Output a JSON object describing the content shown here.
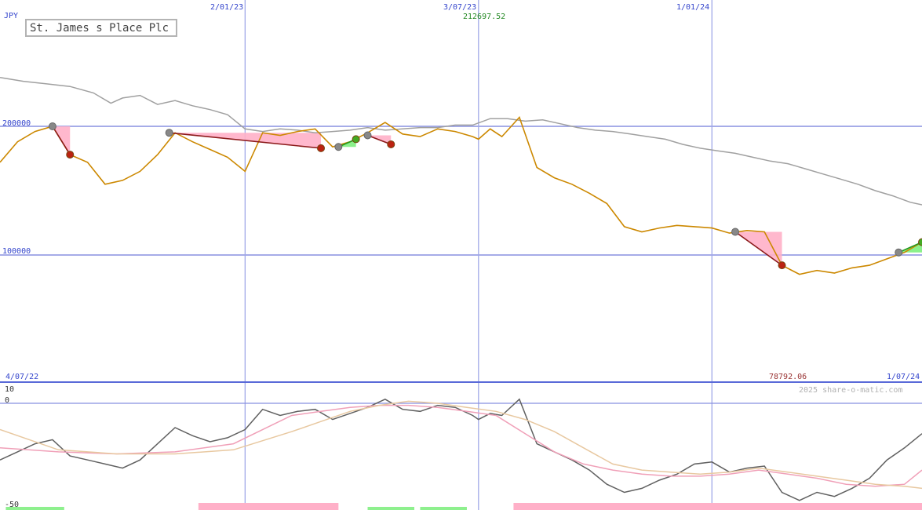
{
  "chart_data": {
    "type": "line",
    "title": "St. James s Place Plc",
    "currency": "JPY",
    "watermark": "2025 share-o-matic.com",
    "start_date_label": "4/07/22",
    "end_date_label": "1/07/24",
    "x_gridlines": [
      {
        "label": "2/01/23",
        "x": 42
      },
      {
        "label": "3/07/23",
        "x": 82
      },
      {
        "label": "1/01/24",
        "x": 122
      }
    ],
    "price_axis": {
      "ylim": [
        20000,
        300000
      ],
      "ticks": [
        {
          "label": "200000",
          "value": 200000
        },
        {
          "label": "100000",
          "value": 100000
        }
      ],
      "max_label": "212697.52",
      "min_label": "78792.06",
      "max_value": 212697.52,
      "min_value": 78792.06
    },
    "price_series": {
      "name": "",
      "color": "#cc8800",
      "x": [
        0,
        3,
        6,
        9,
        12,
        15,
        18,
        21,
        24,
        27,
        30,
        33,
        36,
        39,
        42,
        45,
        48,
        51,
        54,
        57,
        60,
        63,
        66,
        69,
        72,
        75,
        78,
        81,
        82,
        84,
        86,
        89,
        92,
        95,
        98,
        101,
        104,
        107,
        110,
        113,
        116,
        119,
        122,
        125,
        128,
        131,
        134,
        137,
        140,
        143,
        146,
        149,
        152,
        155,
        158
      ],
      "values": [
        172000,
        188000,
        196000,
        200000,
        178000,
        172000,
        155000,
        158000,
        165000,
        178000,
        195000,
        188000,
        182000,
        176000,
        165000,
        195000,
        193000,
        196000,
        198000,
        184000,
        188000,
        195000,
        203000,
        194000,
        192000,
        198000,
        196000,
        192000,
        190000,
        198000,
        192000,
        207000,
        168000,
        160000,
        155000,
        148000,
        140000,
        122000,
        118000,
        121000,
        123000,
        122000,
        121000,
        117000,
        119000,
        118000,
        92000,
        85000,
        88000,
        86000,
        90000,
        92000,
        97000,
        102000,
        110000
      ]
    },
    "comparison_series": {
      "name": "",
      "color": "#a0a0a0",
      "x": [
        0,
        4,
        8,
        12,
        16,
        19,
        21,
        24,
        27,
        30,
        33,
        36,
        39,
        42,
        45,
        48,
        51,
        54,
        57,
        60,
        63,
        66,
        69,
        72,
        75,
        78,
        81,
        84,
        87,
        90,
        93,
        96,
        99,
        102,
        105,
        108,
        111,
        114,
        117,
        120,
        123,
        126,
        129,
        132,
        135,
        138,
        141,
        144,
        147,
        150,
        153,
        156,
        158
      ],
      "values": [
        238000,
        235000,
        233000,
        231000,
        226000,
        218000,
        222000,
        224000,
        217000,
        220000,
        216000,
        213000,
        209000,
        198000,
        196000,
        198000,
        197000,
        195000,
        196000,
        197000,
        199000,
        197000,
        198000,
        199000,
        199000,
        201000,
        201000,
        206000,
        206000,
        204000,
        205000,
        202000,
        199000,
        197000,
        196000,
        194000,
        192000,
        190000,
        186000,
        183000,
        181000,
        179000,
        176000,
        173000,
        171000,
        167000,
        163000,
        159000,
        155000,
        150000,
        146000,
        141000,
        139000
      ]
    },
    "signals": [
      {
        "kind": "loss",
        "from": [
          9,
          200000
        ],
        "to": [
          12,
          178000
        ]
      },
      {
        "kind": "loss",
        "from": [
          29,
          195000
        ],
        "to": [
          55,
          183000
        ]
      },
      {
        "kind": "gain",
        "from": [
          58,
          184000
        ],
        "to": [
          61,
          190000
        ]
      },
      {
        "kind": "loss",
        "from": [
          63,
          193000
        ],
        "to": [
          67,
          186000
        ]
      },
      {
        "kind": "loss",
        "from": [
          126,
          118000
        ],
        "to": [
          134,
          92000
        ]
      },
      {
        "kind": "gain",
        "from": [
          154,
          102000
        ],
        "to": [
          158,
          110000
        ]
      }
    ],
    "indicator_panel": {
      "ylim": [
        -50,
        15
      ],
      "ticks": [
        {
          "label": "10",
          "value": 10
        },
        {
          "label": "0",
          "value": 0
        },
        {
          "label": "-50",
          "value": -50
        }
      ],
      "series": [
        {
          "name": "",
          "color": "#606060",
          "x": [
            0,
            3,
            6,
            9,
            12,
            15,
            18,
            21,
            24,
            27,
            30,
            33,
            36,
            39,
            42,
            45,
            48,
            51,
            54,
            57,
            60,
            63,
            66,
            69,
            72,
            75,
            78,
            81,
            82,
            84,
            86,
            89,
            92,
            95,
            98,
            101,
            104,
            107,
            110,
            113,
            116,
            119,
            122,
            125,
            128,
            131,
            134,
            137,
            140,
            143,
            146,
            149,
            152,
            155,
            158
          ],
          "values": [
            -28,
            -24,
            -20,
            -18,
            -26,
            -28,
            -30,
            -32,
            -28,
            -20,
            -12,
            -16,
            -19,
            -17,
            -13,
            -3,
            -6,
            -4,
            -3,
            -8,
            -5,
            -2,
            2,
            -3,
            -4,
            -1,
            -2,
            -6,
            -8,
            -5,
            -6,
            2,
            -20,
            -24,
            -28,
            -33,
            -40,
            -44,
            -42,
            -38,
            -35,
            -30,
            -29,
            -34,
            -32,
            -31,
            -44,
            -48,
            -44,
            -46,
            -42,
            -37,
            -28,
            -22,
            -15
          ]
        },
        {
          "name": "",
          "color": "#f0a0b8",
          "x": [
            0,
            10,
            20,
            30,
            40,
            50,
            55,
            60,
            65,
            70,
            75,
            80,
            85,
            90,
            95,
            100,
            105,
            110,
            115,
            120,
            125,
            130,
            135,
            140,
            145,
            150,
            155,
            158
          ],
          "values": [
            -22,
            -24,
            -25,
            -24,
            -20,
            -6,
            -4,
            -2,
            -1,
            -1,
            -2,
            -4,
            -6,
            -15,
            -24,
            -30,
            -33,
            -35,
            -36,
            -36,
            -35,
            -33,
            -35,
            -37,
            -40,
            -41,
            -40,
            -33
          ]
        },
        {
          "name": "",
          "color": "#e8c8a0",
          "x": [
            0,
            10,
            20,
            30,
            40,
            50,
            55,
            60,
            65,
            70,
            75,
            80,
            85,
            90,
            95,
            100,
            105,
            110,
            115,
            120,
            125,
            130,
            135,
            140,
            145,
            150,
            155,
            158
          ],
          "values": [
            -13,
            -23,
            -25,
            -25,
            -23,
            -14,
            -9,
            -4,
            -1,
            1,
            0,
            -2,
            -4,
            -8,
            -14,
            -22,
            -30,
            -33,
            -34,
            -35,
            -34,
            -32,
            -34,
            -36,
            -38,
            -40,
            -41,
            -42
          ]
        }
      ],
      "volume_pink": [
        {
          "x": [
            34,
            58
          ]
        },
        {
          "x": [
            88,
            158
          ]
        }
      ],
      "volume_green": [
        {
          "x": [
            1,
            11
          ]
        },
        {
          "x": [
            63,
            71
          ]
        },
        {
          "x": [
            72,
            80
          ]
        }
      ]
    }
  }
}
